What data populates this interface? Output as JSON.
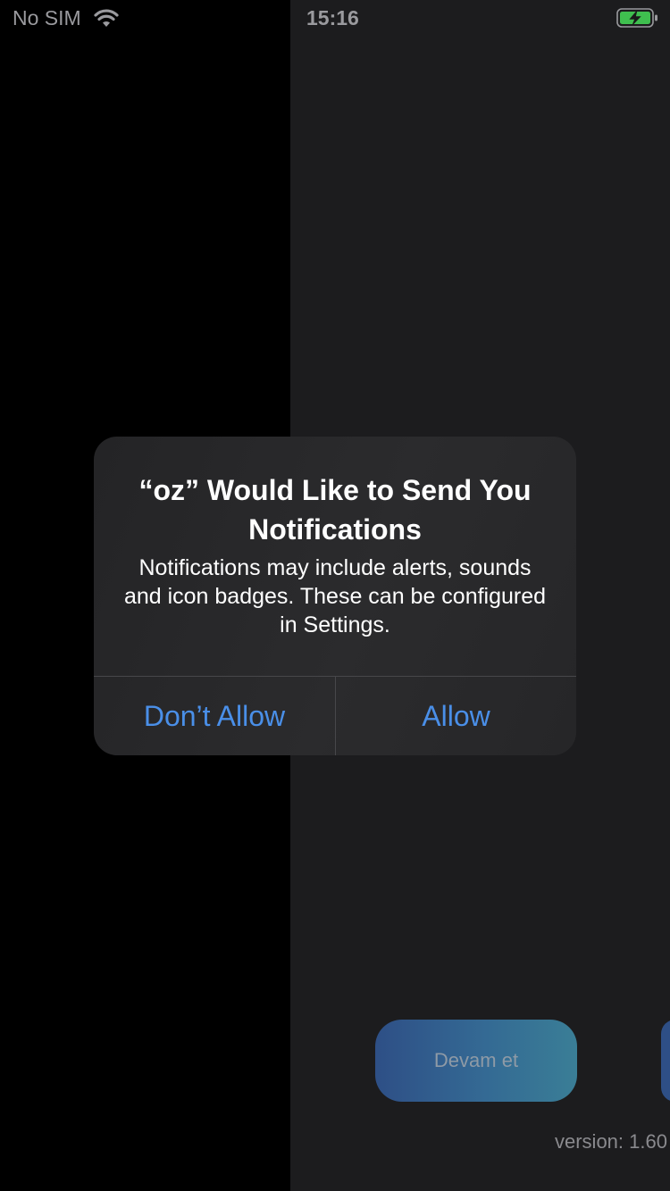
{
  "status_bar": {
    "carrier": "No SIM",
    "time": "15:16",
    "wifi_icon": "wifi-icon",
    "battery_icon": "battery-charging-icon",
    "battery_color": "#3fbf4f"
  },
  "alert": {
    "title": "“oz” Would Like to Send You Notifications",
    "message": "Notifications may include alerts, sounds and icon badges. These can be configured in Settings.",
    "dont_allow_label": "Don’t Allow",
    "allow_label": "Allow",
    "accent_color": "#4a8fe8"
  },
  "app": {
    "continue_label": "Devam et",
    "version_label": "version:  1.60"
  }
}
